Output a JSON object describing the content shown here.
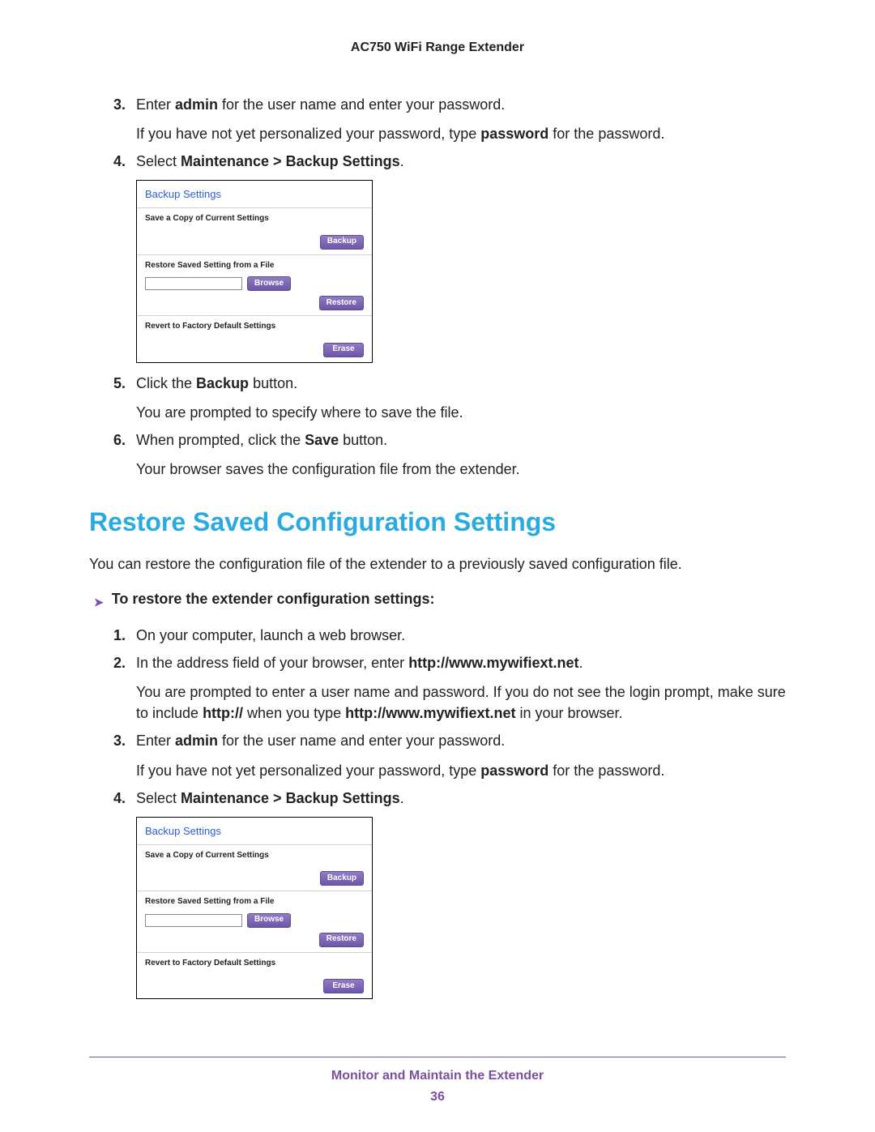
{
  "doc_header": "AC750 WiFi Range Extender",
  "steps_a": {
    "3_num": "3.",
    "3_pre": "Enter ",
    "3_bold": "admin",
    "3_post": " for the user name and enter your password.",
    "3_extra_pre": "If you have not yet personalized your password, type ",
    "3_extra_bold": "password",
    "3_extra_post": " for the password.",
    "4_num": "4.",
    "4_pre": "Select ",
    "4_bold": "Maintenance > Backup Settings",
    "4_post": ".",
    "5_num": "5.",
    "5_pre": "Click the ",
    "5_bold": "Backup",
    "5_post": " button.",
    "5_extra": "You are prompted to specify where to save the file.",
    "6_num": "6.",
    "6_pre": "When prompted, click the ",
    "6_bold": "Save",
    "6_post": " button.",
    "6_extra": "Your browser saves the configuration file from the extender."
  },
  "panel": {
    "title": "Backup Settings",
    "save_copy_label": "Save a Copy of Current Settings",
    "backup_btn": "Backup",
    "restore_label": "Restore Saved Setting from a File",
    "browse_btn": "Browse",
    "restore_btn": "Restore",
    "revert_label": "Revert to Factory Default Settings",
    "erase_btn": "Erase"
  },
  "section_title": "Restore Saved Configuration Settings",
  "section_body": "You can restore the configuration file of the extender to a previously saved configuration file.",
  "subproc_title": "To restore the extender configuration settings:",
  "steps_b": {
    "1_num": "1.",
    "1_text": "On your computer, launch a web browser.",
    "2_num": "2.",
    "2_pre": "In the address field of your browser, enter ",
    "2_bold": "http://www.mywifiext.net",
    "2_post": ".",
    "2_extra_a": "You are prompted to enter a user name and password. If you do not see the login prompt, make sure to include ",
    "2_extra_bold1": "http://",
    "2_extra_mid": " when you type ",
    "2_extra_bold2": "http://www.mywifiext.net",
    "2_extra_end": " in your browser.",
    "3_num": "3.",
    "3_pre": "Enter ",
    "3_bold": "admin",
    "3_post": " for the user name and enter your password.",
    "3_extra_pre": "If you have not yet personalized your password, type ",
    "3_extra_bold": "password",
    "3_extra_post": " for the password.",
    "4_num": "4.",
    "4_pre": "Select ",
    "4_bold": "Maintenance > Backup Settings",
    "4_post": "."
  },
  "footer_title": "Monitor and Maintain the Extender",
  "footer_page": "36"
}
